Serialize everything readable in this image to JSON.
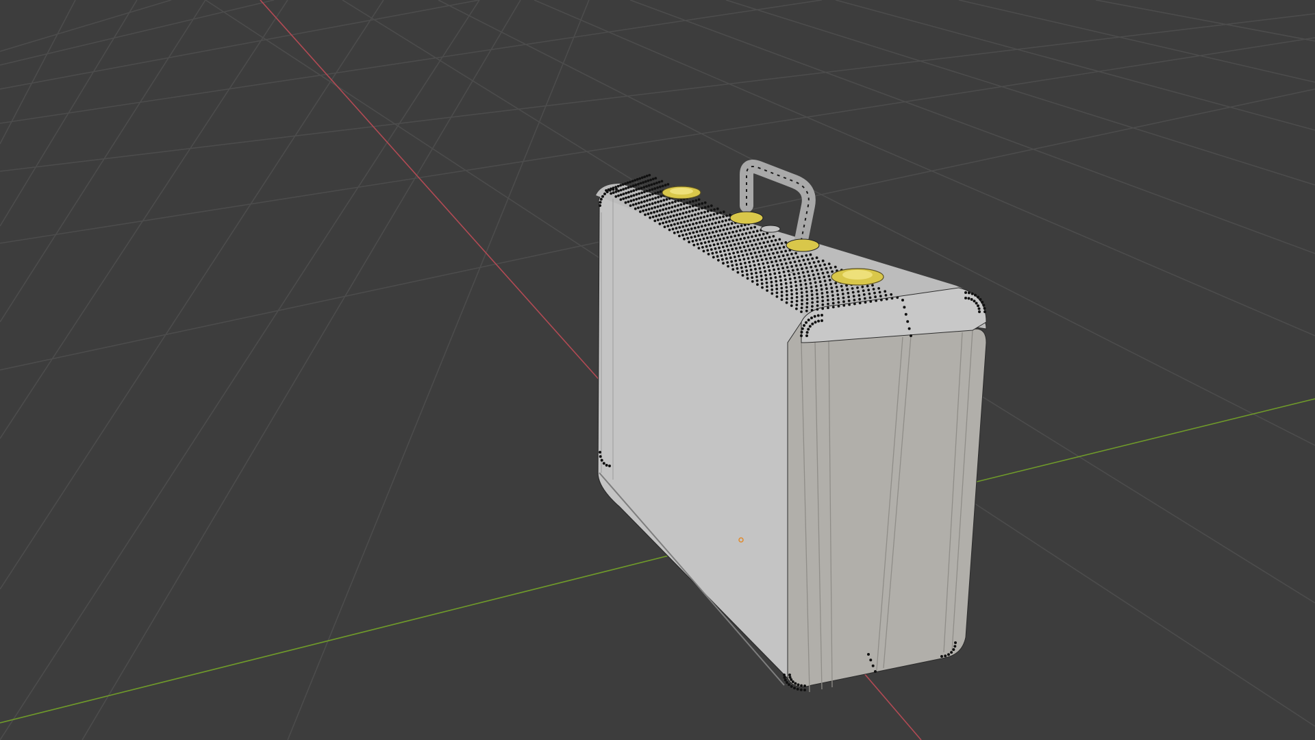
{
  "viewport": {
    "background_color": "#3d3d3d",
    "grid_color": "#4a4a4a",
    "x_axis_color": "#b24a54",
    "y_axis_color": "#6f9a2a"
  },
  "object": {
    "type": "briefcase",
    "state": "edit-mode-vertices-visible",
    "body_color": "#c2c2c2",
    "body_shadow_color": "#a9a7a2",
    "latch_color": "#d9c74a",
    "vertex_color": "#111111",
    "origin_color": "#e08a2c"
  }
}
